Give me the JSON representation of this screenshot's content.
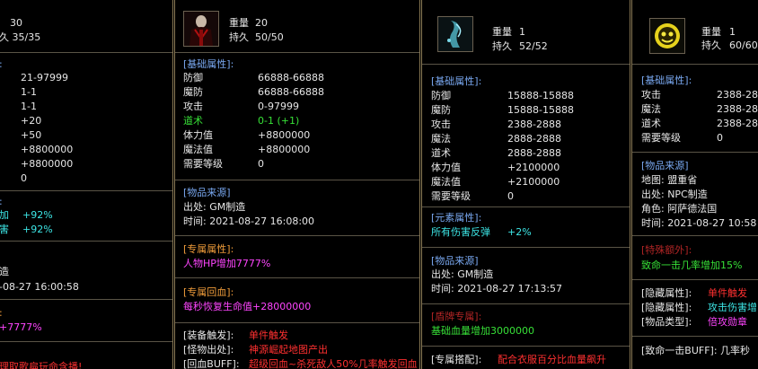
{
  "panel1": {
    "weight": "30",
    "durability": "久 35/35",
    "section1_header": ":",
    "values": [
      "21-97999",
      "1-1",
      "1-1",
      "+20",
      "+50",
      "+8800000",
      "+8800000",
      "0"
    ],
    "elem_header": ":",
    "elem_rows": [
      {
        "label": "加",
        "value": "+92%"
      },
      {
        "label": "害",
        "value": "+92%"
      }
    ],
    "source_text": "造",
    "source_time": "-08-27 16:00:58",
    "excl_header": ":",
    "excl_value": "+7777%",
    "bottom_text": "理取歌扁玩命含播!"
  },
  "panel2": {
    "weight_label": "重量",
    "weight": "20",
    "dur_label": "持久",
    "durability": "50/50",
    "base_header": "[基础属性]:",
    "base_rows": [
      {
        "label": "防御",
        "value": "66888-66888",
        "color": "w"
      },
      {
        "label": "魔防",
        "value": "66888-66888",
        "color": "w"
      },
      {
        "label": "攻击",
        "value": "0-97999",
        "color": "w"
      },
      {
        "label": "道术",
        "value": "0-1 (+1)",
        "color": "g"
      },
      {
        "label": "体力值",
        "value": "+8800000",
        "color": "w"
      },
      {
        "label": "魔法值",
        "value": "+8800000",
        "color": "w"
      },
      {
        "label": "需要等级",
        "value": "0",
        "color": "w"
      }
    ],
    "source_header": "[物品来源]",
    "source_out": "出处: GM制造",
    "source_time": "时间: 2021-08-27 16:08:00",
    "excl_header": "[专属属性]:",
    "excl_text": "人物HP增加7777%",
    "regen_header": "[专属回血]:",
    "regen_text": "每秒恢复生命值+28000000",
    "equip_label": "[装备触发]:",
    "equip_value": "单件触发",
    "monster_label": "[怪物出处]:",
    "monster_value": "神源崛起地图产出",
    "buff_label": "[回血BUFF]:",
    "buff_value": "超级回血~杀死敌人50%几率触发回血"
  },
  "panel3": {
    "weight_label": "重量",
    "weight": "1",
    "dur_label": "持久",
    "durability": "52/52",
    "base_header": "[基础属性]:",
    "base_rows": [
      {
        "label": "防御",
        "value": "15888-15888"
      },
      {
        "label": "魔防",
        "value": "15888-15888"
      },
      {
        "label": "攻击",
        "value": "2388-2888"
      },
      {
        "label": "魔法",
        "value": "2888-2888"
      },
      {
        "label": "道术",
        "value": "2888-2888"
      },
      {
        "label": "体力值",
        "value": "+2100000"
      },
      {
        "label": "魔法值",
        "value": "+2100000"
      },
      {
        "label": "需要等级",
        "value": "0"
      }
    ],
    "elem_header": "[元素属性]:",
    "elem_label": "所有伤害反弹",
    "elem_value": "+2%",
    "source_header": "[物品来源]",
    "source_out": "出处: GM制造",
    "source_time": "时间: 2021-08-27 17:13:57",
    "shield_header": "[盾牌专属]:",
    "shield_text": "基础血量增加3000000",
    "match_label": "[专属搭配]:",
    "match_value": "配合衣服百分比血量飙升"
  },
  "panel4": {
    "weight_label": "重量",
    "weight": "1",
    "dur_label": "持久",
    "durability": "60/60",
    "base_header": "[基础属性]:",
    "base_rows": [
      {
        "label": "攻击",
        "value": "2388-288"
      },
      {
        "label": "魔法",
        "value": "2388-288"
      },
      {
        "label": "道术",
        "value": "2388-288"
      },
      {
        "label": "需要等级",
        "value": "0"
      }
    ],
    "source_header": "[物品来源]",
    "source_map": "地图: 盟重省",
    "source_out": "出处: NPC制造",
    "source_role": "角色: 阿萨德法国",
    "source_time": "时间: 2021-08-27 10:58",
    "special_header": "[特殊额外]:",
    "special_text": "致命一击几率增加15%",
    "hidden_label": "[隐藏属性]:",
    "hidden_value": "单件触发",
    "hidden2_label": "[隐藏属性]:",
    "hidden2_value": "攻击伤害增",
    "type_label": "[物品类型]:",
    "type_value": "倍攻勋章",
    "crit_buff": "[致命一击BUFF]: 几率秒"
  }
}
